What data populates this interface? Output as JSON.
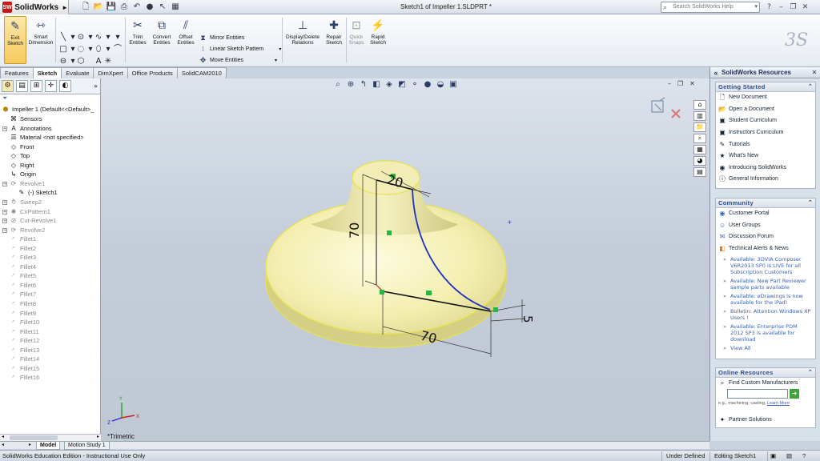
{
  "app": {
    "logo_text": "SolidWorks",
    "logo_badge": "SW",
    "document_title": "Sketch1 of Impeller 1.SLDPRT *",
    "search_placeholder": "Search SolidWorks Help"
  },
  "ribbon": {
    "exit_sketch": "Exit Sketch",
    "smart_dimension": "Smart Dimension",
    "trim_entities": "Trim Entities",
    "convert_entities": "Convert Entities",
    "offset_entities": "Offset Entities",
    "mirror_entities": "Mirror Entities",
    "linear_sketch_pattern": "Linear Sketch Pattern",
    "move_entities": "Move Entities",
    "display_delete_relations": "Display/Delete Relations",
    "repair_sketch": "Repair Sketch",
    "quick_snaps": "Quick Snaps",
    "rapid_sketch": "Rapid Sketch",
    "brand_mark": "3S"
  },
  "tabs": [
    "Features",
    "Sketch",
    "Evaluate",
    "DimXpert",
    "Office Products",
    "SolidCAM2010"
  ],
  "active_tab": "Sketch",
  "feature_tree": {
    "root": "Impeller 1  (Default<<Default>_",
    "items": [
      {
        "label": "Sensors",
        "icon": "sensor-icon"
      },
      {
        "label": "Annotations",
        "icon": "annotation-icon"
      },
      {
        "label": "Material <not specified>",
        "icon": "material-icon"
      },
      {
        "label": "Front",
        "icon": "plane-icon"
      },
      {
        "label": "Top",
        "icon": "plane-icon"
      },
      {
        "label": "Right",
        "icon": "plane-icon"
      },
      {
        "label": "Origin",
        "icon": "origin-icon"
      },
      {
        "label": "Revolve1",
        "icon": "revolve-icon"
      },
      {
        "label": "(-) Sketch1",
        "icon": "sketch-icon"
      },
      {
        "label": "Sweep2",
        "icon": "sweep-icon"
      },
      {
        "label": "CirPattern1",
        "icon": "pattern-icon"
      },
      {
        "label": "Cut-Revolve1",
        "icon": "cut-icon"
      },
      {
        "label": "Revolve2",
        "icon": "revolve-icon"
      },
      {
        "label": "Fillet1",
        "icon": "fillet-icon"
      },
      {
        "label": "Fillet2",
        "icon": "fillet-icon"
      },
      {
        "label": "Fillet3",
        "icon": "fillet-icon"
      },
      {
        "label": "Fillet4",
        "icon": "fillet-icon"
      },
      {
        "label": "Fillet5",
        "icon": "fillet-icon"
      },
      {
        "label": "Fillet6",
        "icon": "fillet-icon"
      },
      {
        "label": "Fillet7",
        "icon": "fillet-icon"
      },
      {
        "label": "Fillet8",
        "icon": "fillet-icon"
      },
      {
        "label": "Fillet9",
        "icon": "fillet-icon"
      },
      {
        "label": "Fillet10",
        "icon": "fillet-icon"
      },
      {
        "label": "Fillet11",
        "icon": "fillet-icon"
      },
      {
        "label": "Fillet12",
        "icon": "fillet-icon"
      },
      {
        "label": "Fillet13",
        "icon": "fillet-icon"
      },
      {
        "label": "Fillet14",
        "icon": "fillet-icon"
      },
      {
        "label": "Fillet15",
        "icon": "fillet-icon"
      },
      {
        "label": "Fillet16",
        "icon": "fillet-icon"
      }
    ]
  },
  "viewport": {
    "view_name": "*Trimetric",
    "dimensions": [
      "20",
      "70",
      "70",
      "5"
    ],
    "triad": {
      "x": "X",
      "y": "Y",
      "z": "Z"
    }
  },
  "task_pane": {
    "title": "SolidWorks Resources",
    "getting_started": {
      "heading": "Getting Started",
      "items": [
        "New Document",
        "Open a Document",
        "Student Curriculum",
        "Instructors Curriculum",
        "Tutorials",
        "What's New",
        "Introducing SolidWorks",
        "General Information"
      ]
    },
    "community": {
      "heading": "Community",
      "items": [
        "Customer Portal",
        "User Groups",
        "Discussion Forum",
        "Technical Alerts & News"
      ],
      "news": [
        "Available: 3DVIA Composer V6R2013 SP0 is LIVE for all Subscription Customers",
        "Available: New Part Reviewer sample parts available",
        "Available: eDrawings is now available for the iPad!",
        "Bulletin: Attention Windows XP Users !",
        "Available: Enterprise PDM 2012 SP3 is available for download"
      ],
      "view_all": "View All"
    },
    "online": {
      "heading": "Online Resources",
      "find_mfr": "Find Custom Manufacturers",
      "hint": "e.g., machining, casting,",
      "learn_more": "Learn More",
      "partner": "Partner Solutions"
    }
  },
  "bottom_tabs": [
    "Model",
    "Motion Study 1"
  ],
  "status": {
    "left": "SolidWorks Education Edition - Instructional Use Only",
    "state": "Under Defined",
    "editing": "Editing Sketch1"
  }
}
